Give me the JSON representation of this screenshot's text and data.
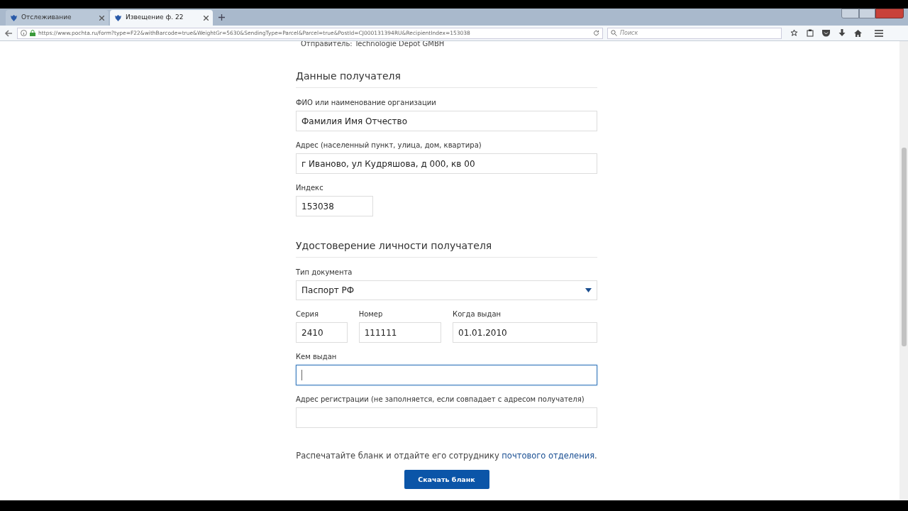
{
  "browser": {
    "tabs": [
      {
        "title": "Отслеживание",
        "selected": false
      },
      {
        "title": "Извещение ф. 22",
        "selected": true
      }
    ],
    "url": "https://www.pochta.ru/form?type=F22&withBarcode=true&WeightGr=5630&SendingType=Parcel&Parcel=true&PostId=CJ000131394RU&RecipientIndex=153038",
    "search": {
      "placeholder": "Поиск"
    }
  },
  "page": {
    "sender_line": "Отправитель: Technologie Depot GMBH",
    "sections": [
      {
        "title": "Данные получателя",
        "rows": [
          [
            {
              "kind": "wide",
              "label": "ФИО или наименование организации",
              "value": "Фамилия Имя Отчество",
              "focused": false
            }
          ],
          [
            {
              "kind": "wide",
              "label": "Адрес (населенный пункт, улица, дом, квартира)",
              "value": "г Иваново, ул Кудряшова, д 000, кв 00",
              "focused": false
            }
          ],
          [
            {
              "kind": "narrow",
              "label": "Индекс",
              "value": "153038",
              "focused": false
            }
          ]
        ]
      },
      {
        "title": "Удостоверение личности получателя",
        "rows": [
          [
            {
              "kind": "select",
              "label": "Тип документа",
              "value": "Паспорт РФ",
              "focused": false
            }
          ],
          [
            {
              "kind": "series",
              "label": "Серия",
              "value": "2410",
              "focused": false
            },
            {
              "kind": "number",
              "label": "Номер",
              "value": "111111",
              "focused": false
            },
            {
              "kind": "date",
              "label": "Когда выдан",
              "value": "01.01.2010",
              "focused": false
            }
          ],
          [
            {
              "kind": "wide",
              "label": "Кем выдан",
              "focused": true
            }
          ],
          [
            {
              "kind": "wide",
              "label": "Адрес регистрации (не заполняется, если совпадает с адресом получателя)",
              "focused": false
            }
          ]
        ]
      }
    ],
    "note": {
      "text": "Распечатайте бланк и отдайте его сотруднику",
      "link": "почтового отделения",
      "end": "."
    },
    "button": "Скачать бланк"
  }
}
